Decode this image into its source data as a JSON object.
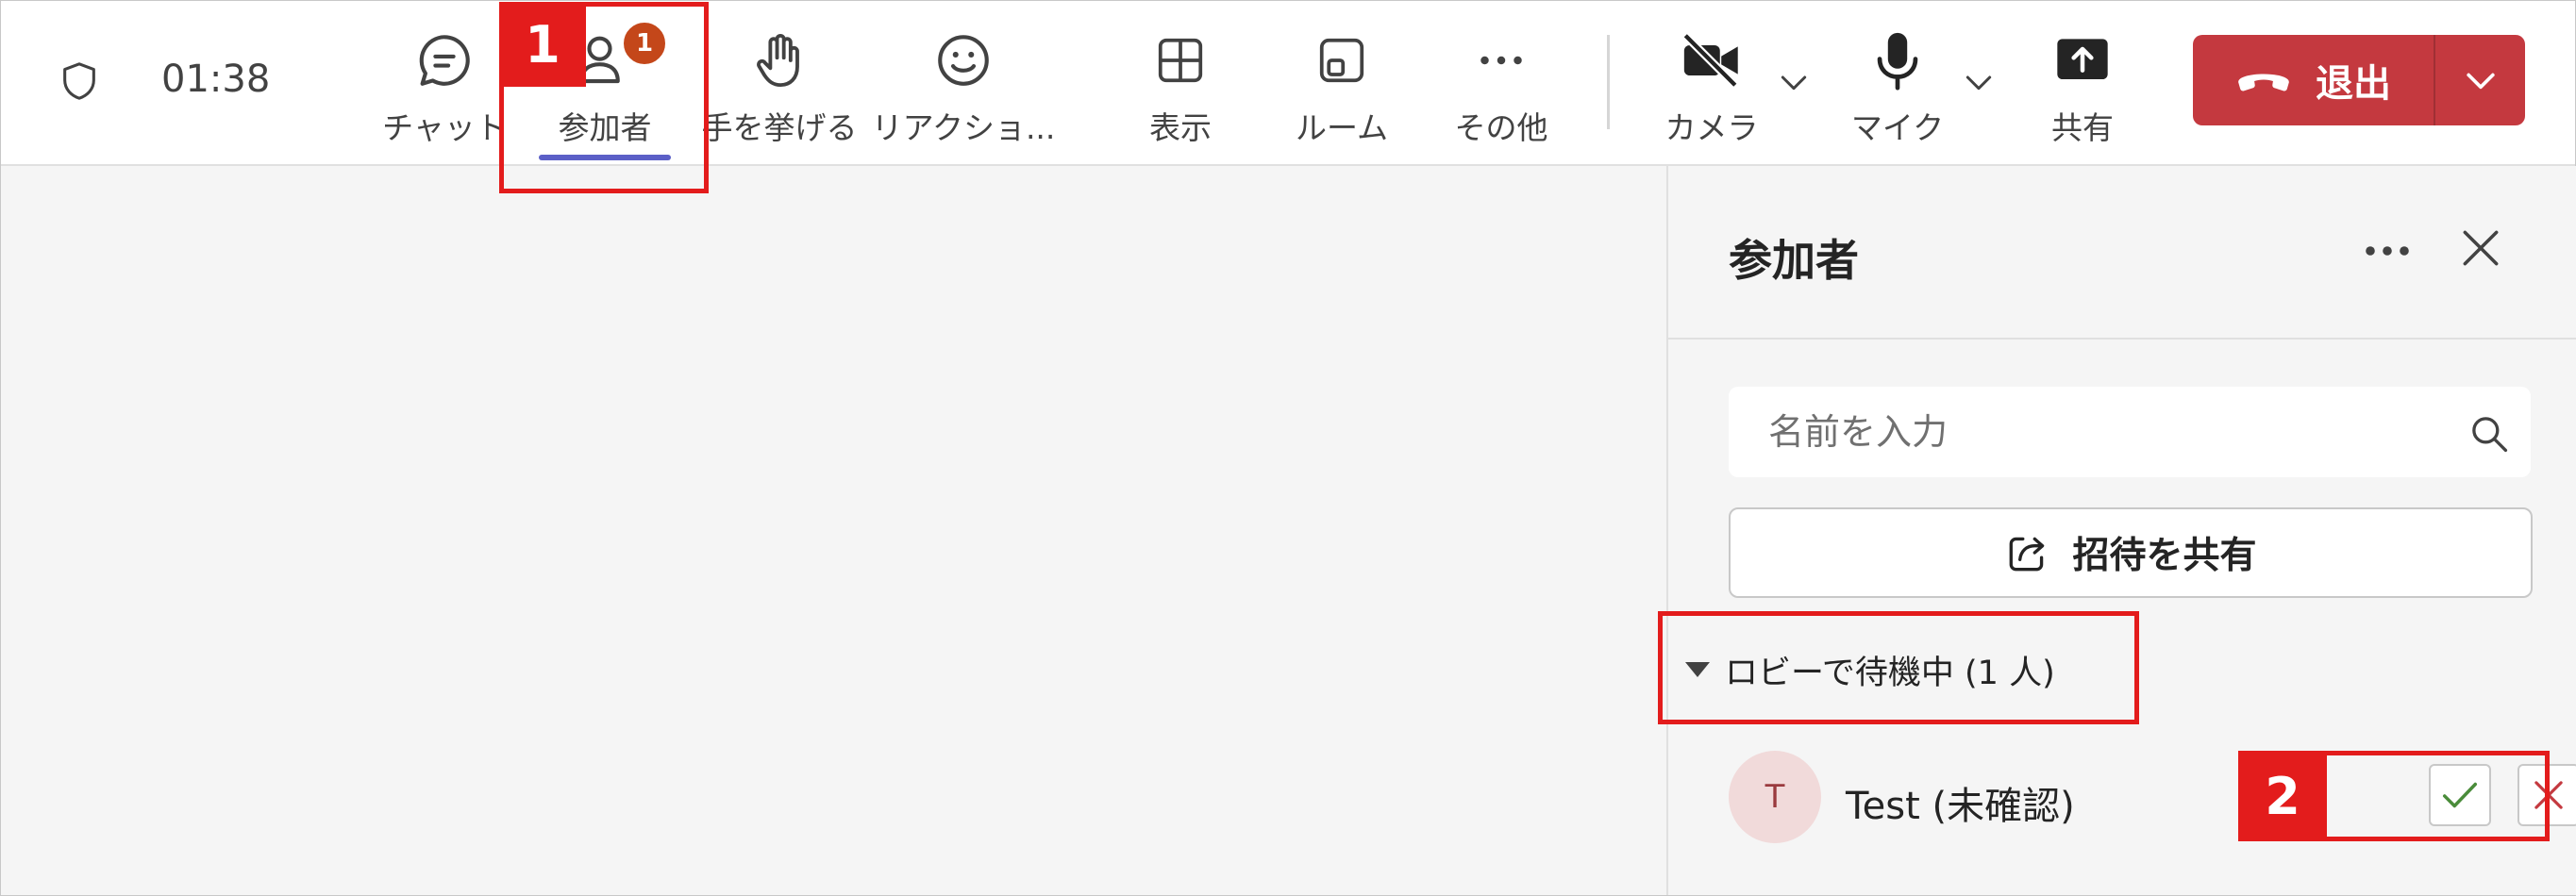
{
  "topbar": {
    "timer": "01:38",
    "buttons": {
      "chat": "チャット",
      "participants": "参加者",
      "raise_hand": "手を挙げる",
      "reactions": "リアクショ...",
      "view": "表示",
      "rooms": "ルーム",
      "more": "その他",
      "camera": "カメラ",
      "mic": "マイク",
      "share": "共有"
    },
    "participants_badge": "1",
    "leave_label": "退出"
  },
  "panel": {
    "title": "参加者",
    "search_placeholder": "名前を入力",
    "invite_label": "招待を共有",
    "lobby_header": "ロビーで待機中 (1 人)",
    "lobby_people": [
      {
        "initial": "T",
        "name": "Test (未確認)"
      }
    ]
  },
  "annotations": {
    "step1": "1",
    "step2": "2"
  },
  "colors": {
    "accent": "#5b5fc7",
    "leave_red": "#c4393f",
    "badge_orange": "#c4471a",
    "highlight_red": "#e31c1c",
    "accept_green": "#4a8c3a",
    "deny_red": "#c4393f"
  }
}
